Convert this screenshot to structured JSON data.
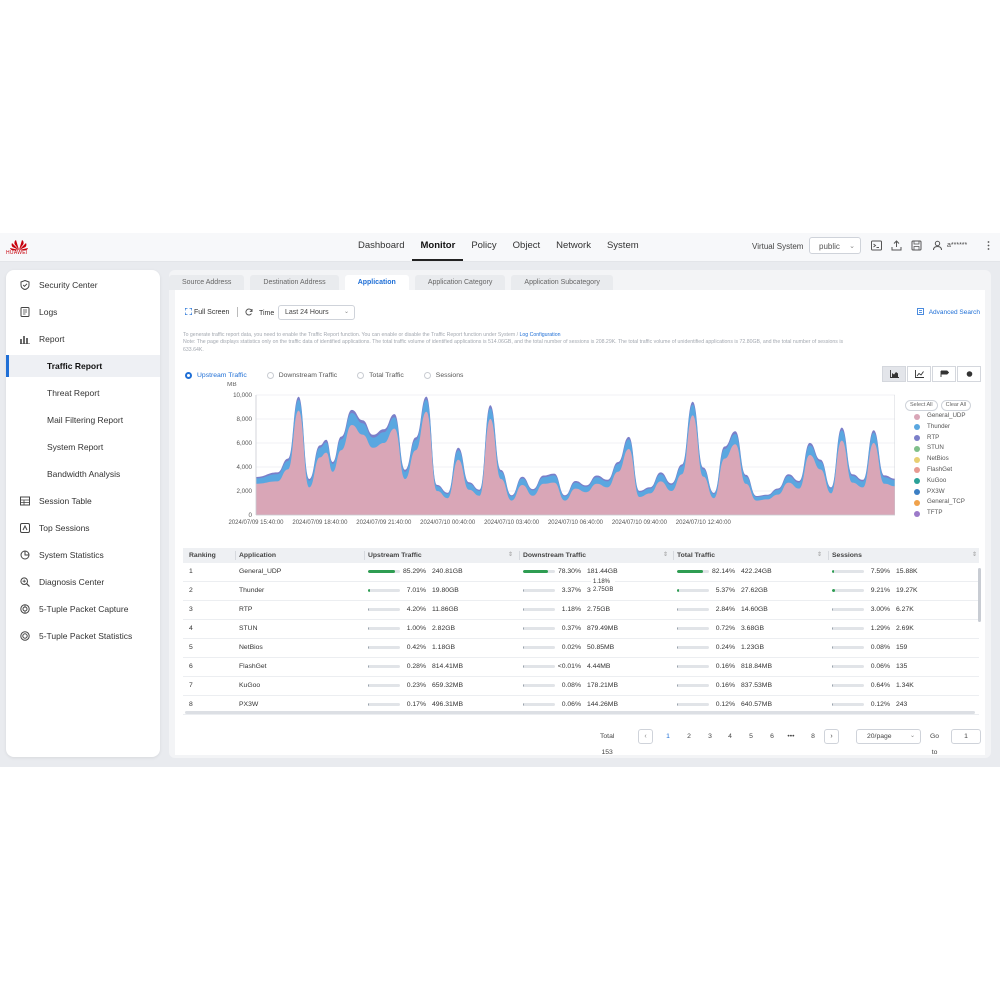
{
  "brand": {
    "name": "HUAWEI",
    "color": "#c7000b"
  },
  "nav": {
    "items": [
      "Dashboard",
      "Monitor",
      "Policy",
      "Object",
      "Network",
      "System"
    ],
    "active": "Monitor"
  },
  "header": {
    "virtual_system_label": "Virtual System",
    "virtual_system_value": "public",
    "username": "a******",
    "icons": [
      "terminal-icon",
      "upload-icon",
      "save-icon",
      "user-icon",
      "more-vertical-icon"
    ]
  },
  "sidebar": {
    "items": [
      {
        "label": "Security Center",
        "icon": "shield-icon"
      },
      {
        "label": "Logs",
        "icon": "log-icon"
      },
      {
        "label": "Report",
        "icon": "bar-chart-icon"
      },
      {
        "label": "Traffic Report",
        "active": true
      },
      {
        "label": "Threat Report"
      },
      {
        "label": "Mail Filtering Report"
      },
      {
        "label": "System Report"
      },
      {
        "label": "Bandwidth Analysis"
      },
      {
        "label": "Session Table",
        "icon": "table-icon"
      },
      {
        "label": "Top Sessions",
        "icon": "top-sessions-icon"
      },
      {
        "label": "System Statistics",
        "icon": "pie-chart-icon"
      },
      {
        "label": "Diagnosis Center",
        "icon": "diagnosis-icon"
      },
      {
        "label": "5-Tuple Packet Capture",
        "icon": "capture-icon"
      },
      {
        "label": "5-Tuple Packet Statistics",
        "icon": "statistics-icon"
      }
    ]
  },
  "tabs": [
    "Source Address",
    "Destination Address",
    "Application",
    "Application Category",
    "Application Subcategory"
  ],
  "active_tab": "Application",
  "toolbar": {
    "full_screen": "Full Screen",
    "time_label": "Time",
    "time_value": "Last 24 Hours",
    "advanced_search": "Advanced Search"
  },
  "note": {
    "line1_prefix": "To generate traffic report data, you need to enable the Traffic Report function. You can enable or disable the Traffic Report function under System / ",
    "line1_link": "Log Configuration",
    "line2": "Note: The page displays statistics only on the traffic data of identified applications. The total traffic volume of identified applications is 514.06GB, and the total number of sessions is 208.29K. The total traffic volume of unidentified applications is 72.80GB, and the total number of sessions is",
    "line3": "633.64K."
  },
  "metrics": [
    "Upstream Traffic",
    "Downstream Traffic",
    "Total Traffic",
    "Sessions"
  ],
  "active_metric": "Upstream Traffic",
  "chart_buttons": [
    "area-chart-icon",
    "line-chart-icon",
    "bar-chart-icon",
    "pie-chart-icon"
  ],
  "legend_controls": {
    "select_all": "Select All",
    "clear_all": "Clear All"
  },
  "chart_data": {
    "type": "area",
    "ylabel": "MB",
    "ylim": [
      0,
      10000
    ],
    "yticks": [
      "0",
      "2,000",
      "4,000",
      "6,000",
      "8,000",
      "10,000"
    ],
    "xticks": [
      "2024/07/09 15:40:00",
      "2024/07/09 18:40:00",
      "2024/07/09 21:40:00",
      "2024/07/10 00:40:00",
      "2024/07/10 03:40:00",
      "2024/07/10 06:40:00",
      "2024/07/10 09:40:00",
      "2024/07/10 12:40:00"
    ],
    "grid": true,
    "legend_position": "right",
    "x_hours": [
      0,
      1,
      1.5,
      2,
      2.5,
      3,
      3.3,
      3.6,
      4,
      4.5,
      5,
      5.5,
      6,
      6.5,
      7,
      7.5,
      8,
      8.5,
      9,
      9.5,
      10,
      10.5,
      11,
      11.5,
      12,
      12.5,
      13,
      13.5,
      14,
      14.5,
      15,
      15.5,
      16,
      16.5,
      17,
      17.5,
      18,
      18.5,
      19,
      19.5,
      20,
      20.5,
      21,
      21.5,
      22,
      22.5,
      23,
      23.5,
      24,
      24.5,
      25,
      25.5,
      26,
      26.5,
      27,
      27.5,
      28,
      28.5,
      29,
      29.5,
      30
    ],
    "series": [
      {
        "name": "General_UDP",
        "color": "#d9a6b7",
        "values": [
          2600,
          2800,
          3800,
          8700,
          2300,
          4800,
          5200,
          3600,
          5400,
          7500,
          6700,
          5600,
          6000,
          7200,
          3000,
          5400,
          8600,
          2000,
          1400,
          4600,
          2100,
          1600,
          8000,
          3000,
          1200,
          2500,
          1600,
          2600,
          2700,
          1200,
          2200,
          1900,
          2600,
          2300,
          3600,
          5500,
          1500,
          1800,
          2800,
          2000,
          3400,
          8300,
          3200,
          1400,
          4700,
          5900,
          2600,
          1200,
          1300,
          1700,
          2700,
          2200,
          5000,
          3800,
          1800,
          6200,
          2700,
          2300,
          6000,
          2600,
          2400
        ]
      },
      {
        "name": "Thunder",
        "color": "#5aa7e0",
        "values": [
          450,
          600,
          700,
          900,
          550,
          800,
          850,
          650,
          900,
          1000,
          950,
          850,
          900,
          950,
          600,
          850,
          1000,
          400,
          350,
          800,
          500,
          400,
          900,
          600,
          350,
          550,
          450,
          550,
          600,
          350,
          500,
          450,
          550,
          500,
          650,
          800,
          400,
          400,
          600,
          500,
          650,
          900,
          600,
          350,
          800,
          850,
          600,
          300,
          300,
          400,
          550,
          500,
          800,
          650,
          400,
          850,
          550,
          500,
          850,
          550,
          500
        ]
      },
      {
        "name": "RTP",
        "color": "#7b7fc9",
        "values": [
          120,
          150,
          200,
          250,
          150,
          200,
          220,
          170,
          230,
          260,
          250,
          230,
          240,
          260,
          170,
          220,
          270,
          110,
          100,
          210,
          130,
          110,
          240,
          150,
          90,
          140,
          110,
          140,
          150,
          90,
          130,
          120,
          140,
          130,
          170,
          210,
          110,
          110,
          150,
          130,
          170,
          240,
          160,
          90,
          210,
          230,
          150,
          80,
          80,
          110,
          140,
          130,
          210,
          170,
          100,
          230,
          150,
          130,
          220,
          150,
          130
        ]
      },
      {
        "name": "STUN",
        "color": "#7fbf8a",
        "values": []
      },
      {
        "name": "NetBios",
        "color": "#e8cf72",
        "values": []
      },
      {
        "name": "FlashGet",
        "color": "#e79a92",
        "values": []
      },
      {
        "name": "KuGoo",
        "color": "#2aa198",
        "values": []
      },
      {
        "name": "PX3W",
        "color": "#3b7fc4",
        "values": []
      },
      {
        "name": "General_TCP",
        "color": "#f0a24b",
        "values": []
      },
      {
        "name": "TFTP",
        "color": "#9c7ac9",
        "values": []
      }
    ]
  },
  "table": {
    "columns": [
      "Ranking",
      "Application",
      "Upstream Traffic",
      "Downstream Traffic",
      "Total Traffic",
      "Sessions"
    ],
    "rows": [
      {
        "rank": "1",
        "app": "General_UDP",
        "up_pct": "85.29%",
        "up_val": "240.81GB",
        "up_bar": 0.8529,
        "down_pct": "78.30%",
        "down_val": "181.44GB",
        "down_bar": 0.783,
        "total_pct": "82.14%",
        "total_val": "422.24GB",
        "total_bar": 0.8214,
        "sess_pct": "7.59%",
        "sess_val": "15.88K",
        "sess_bar": 0.0759
      },
      {
        "rank": "2",
        "app": "Thunder",
        "up_pct": "7.01%",
        "up_val": "19.80GB",
        "up_bar": 0.0701,
        "down_pct": "3.37%",
        "down_val": "3",
        "down_bar": 0.0337,
        "total_pct": "5.37%",
        "total_val": "27.62GB",
        "total_bar": 0.0537,
        "sess_pct": "9.21%",
        "sess_val": "19.27K",
        "sess_bar": 0.0921,
        "tooltip": [
          "1.18%",
          "2.75GB"
        ]
      },
      {
        "rank": "3",
        "app": "RTP",
        "up_pct": "4.20%",
        "up_val": "11.86GB",
        "up_bar": 0.042,
        "down_pct": "1.18%",
        "down_val": "2.75GB",
        "down_bar": 0.0118,
        "total_pct": "2.84%",
        "total_val": "14.60GB",
        "total_bar": 0.0284,
        "sess_pct": "3.00%",
        "sess_val": "6.27K",
        "sess_bar": 0.03
      },
      {
        "rank": "4",
        "app": "STUN",
        "up_pct": "1.00%",
        "up_val": "2.82GB",
        "up_bar": 0.01,
        "down_pct": "0.37%",
        "down_val": "879.49MB",
        "down_bar": 0.0037,
        "total_pct": "0.72%",
        "total_val": "3.68GB",
        "total_bar": 0.0072,
        "sess_pct": "1.29%",
        "sess_val": "2.69K",
        "sess_bar": 0.0129
      },
      {
        "rank": "5",
        "app": "NetBios",
        "up_pct": "0.42%",
        "up_val": "1.18GB",
        "up_bar": 0.0042,
        "down_pct": "0.02%",
        "down_val": "50.85MB",
        "down_bar": 0.0002,
        "total_pct": "0.24%",
        "total_val": "1.23GB",
        "total_bar": 0.0024,
        "sess_pct": "0.08%",
        "sess_val": "159",
        "sess_bar": 0.0008
      },
      {
        "rank": "6",
        "app": "FlashGet",
        "up_pct": "0.28%",
        "up_val": "814.41MB",
        "up_bar": 0.0028,
        "down_pct": "<0.01%",
        "down_val": "4.44MB",
        "down_bar": 0.0001,
        "total_pct": "0.16%",
        "total_val": "818.84MB",
        "total_bar": 0.0016,
        "sess_pct": "0.06%",
        "sess_val": "135",
        "sess_bar": 0.0006
      },
      {
        "rank": "7",
        "app": "KuGoo",
        "up_pct": "0.23%",
        "up_val": "659.32MB",
        "up_bar": 0.0023,
        "down_pct": "0.08%",
        "down_val": "178.21MB",
        "down_bar": 0.0008,
        "total_pct": "0.16%",
        "total_val": "837.53MB",
        "total_bar": 0.0016,
        "sess_pct": "0.64%",
        "sess_val": "1.34K",
        "sess_bar": 0.0064
      },
      {
        "rank": "8",
        "app": "PX3W",
        "up_pct": "0.17%",
        "up_val": "496.31MB",
        "up_bar": 0.0017,
        "down_pct": "0.06%",
        "down_val": "144.26MB",
        "down_bar": 0.0006,
        "total_pct": "0.12%",
        "total_val": "640.57MB",
        "total_bar": 0.0012,
        "sess_pct": "0.12%",
        "sess_val": "243",
        "sess_bar": 0.0012
      }
    ]
  },
  "pagination": {
    "total": "Total 153",
    "pages": [
      "1",
      "2",
      "3",
      "4",
      "5",
      "6",
      "•••",
      "8"
    ],
    "current": "1",
    "page_size": "20/page",
    "goto_label": "Go to",
    "goto_value": "1"
  }
}
